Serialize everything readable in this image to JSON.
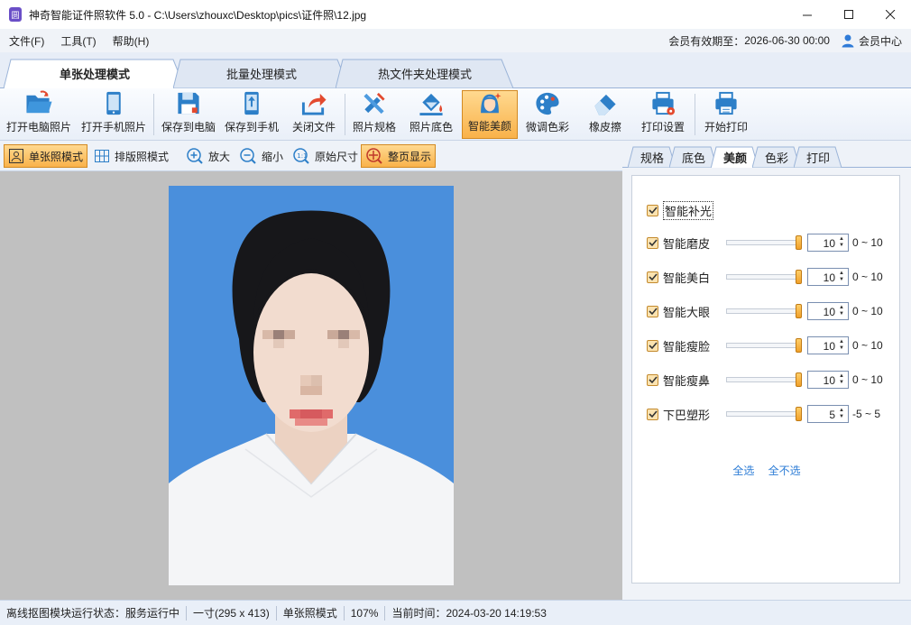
{
  "window": {
    "title": "神奇智能证件照软件 5.0 - C:\\Users\\zhouxc\\Desktop\\pics\\证件照\\12.jpg",
    "app_icon_glyph": "圆"
  },
  "menu": {
    "file": "文件(F)",
    "tools": "工具(T)",
    "help": "帮助(H)"
  },
  "member": {
    "expiry_label": "会员有效期至：",
    "expiry": "2026-06-30 00:00",
    "center": "会员中心"
  },
  "mode_tabs": [
    "单张处理模式",
    "批量处理模式",
    "热文件夹处理模式"
  ],
  "toolbar": {
    "open_pc": "打开电脑照片",
    "open_phone": "打开手机照片",
    "save_pc": "保存到电脑",
    "save_phone": "保存到手机",
    "close_file": "关闭文件",
    "spec": "照片规格",
    "bg_color": "照片底色",
    "beauty": "智能美颜",
    "fine_color": "微调色彩",
    "eraser": "橡皮擦",
    "print_settings": "打印设置",
    "start_print": "开始打印"
  },
  "viewbar": {
    "single": "单张照模式",
    "layout": "排版照模式",
    "zoom_in": "放大",
    "zoom_out": "缩小",
    "original": "原始尺寸",
    "fit_page": "整页显示"
  },
  "right_tabs": [
    "规格",
    "底色",
    "美颜",
    "色彩",
    "打印"
  ],
  "beauty": {
    "fill_light": "智能补光",
    "items": [
      {
        "label": "智能磨皮",
        "value": "10",
        "range": "0 ~ 10",
        "level": 1.0
      },
      {
        "label": "智能美白",
        "value": "10",
        "range": "0 ~ 10",
        "level": 1.0
      },
      {
        "label": "智能大眼",
        "value": "10",
        "range": "0 ~ 10",
        "level": 1.0
      },
      {
        "label": "智能瘦脸",
        "value": "10",
        "range": "0 ~ 10",
        "level": 1.0
      },
      {
        "label": "智能瘦鼻",
        "value": "10",
        "range": "0 ~ 10",
        "level": 1.0
      },
      {
        "label": "下巴塑形",
        "value": "5",
        "range": "-5 ~ 5",
        "level": 1.0
      }
    ],
    "select_all": "全选",
    "select_none": "全不选"
  },
  "status": {
    "service": "离线抠图模块运行状态：服务运行中",
    "size": "一寸(295 x 413)",
    "mode": "单张照模式",
    "zoom": "107%",
    "time": "当前时间：2024-03-20 14:19:53"
  },
  "colors": {
    "accent": "#f9b24a",
    "photo_bg": "#4a8fdc",
    "link": "#2c7cd6"
  }
}
